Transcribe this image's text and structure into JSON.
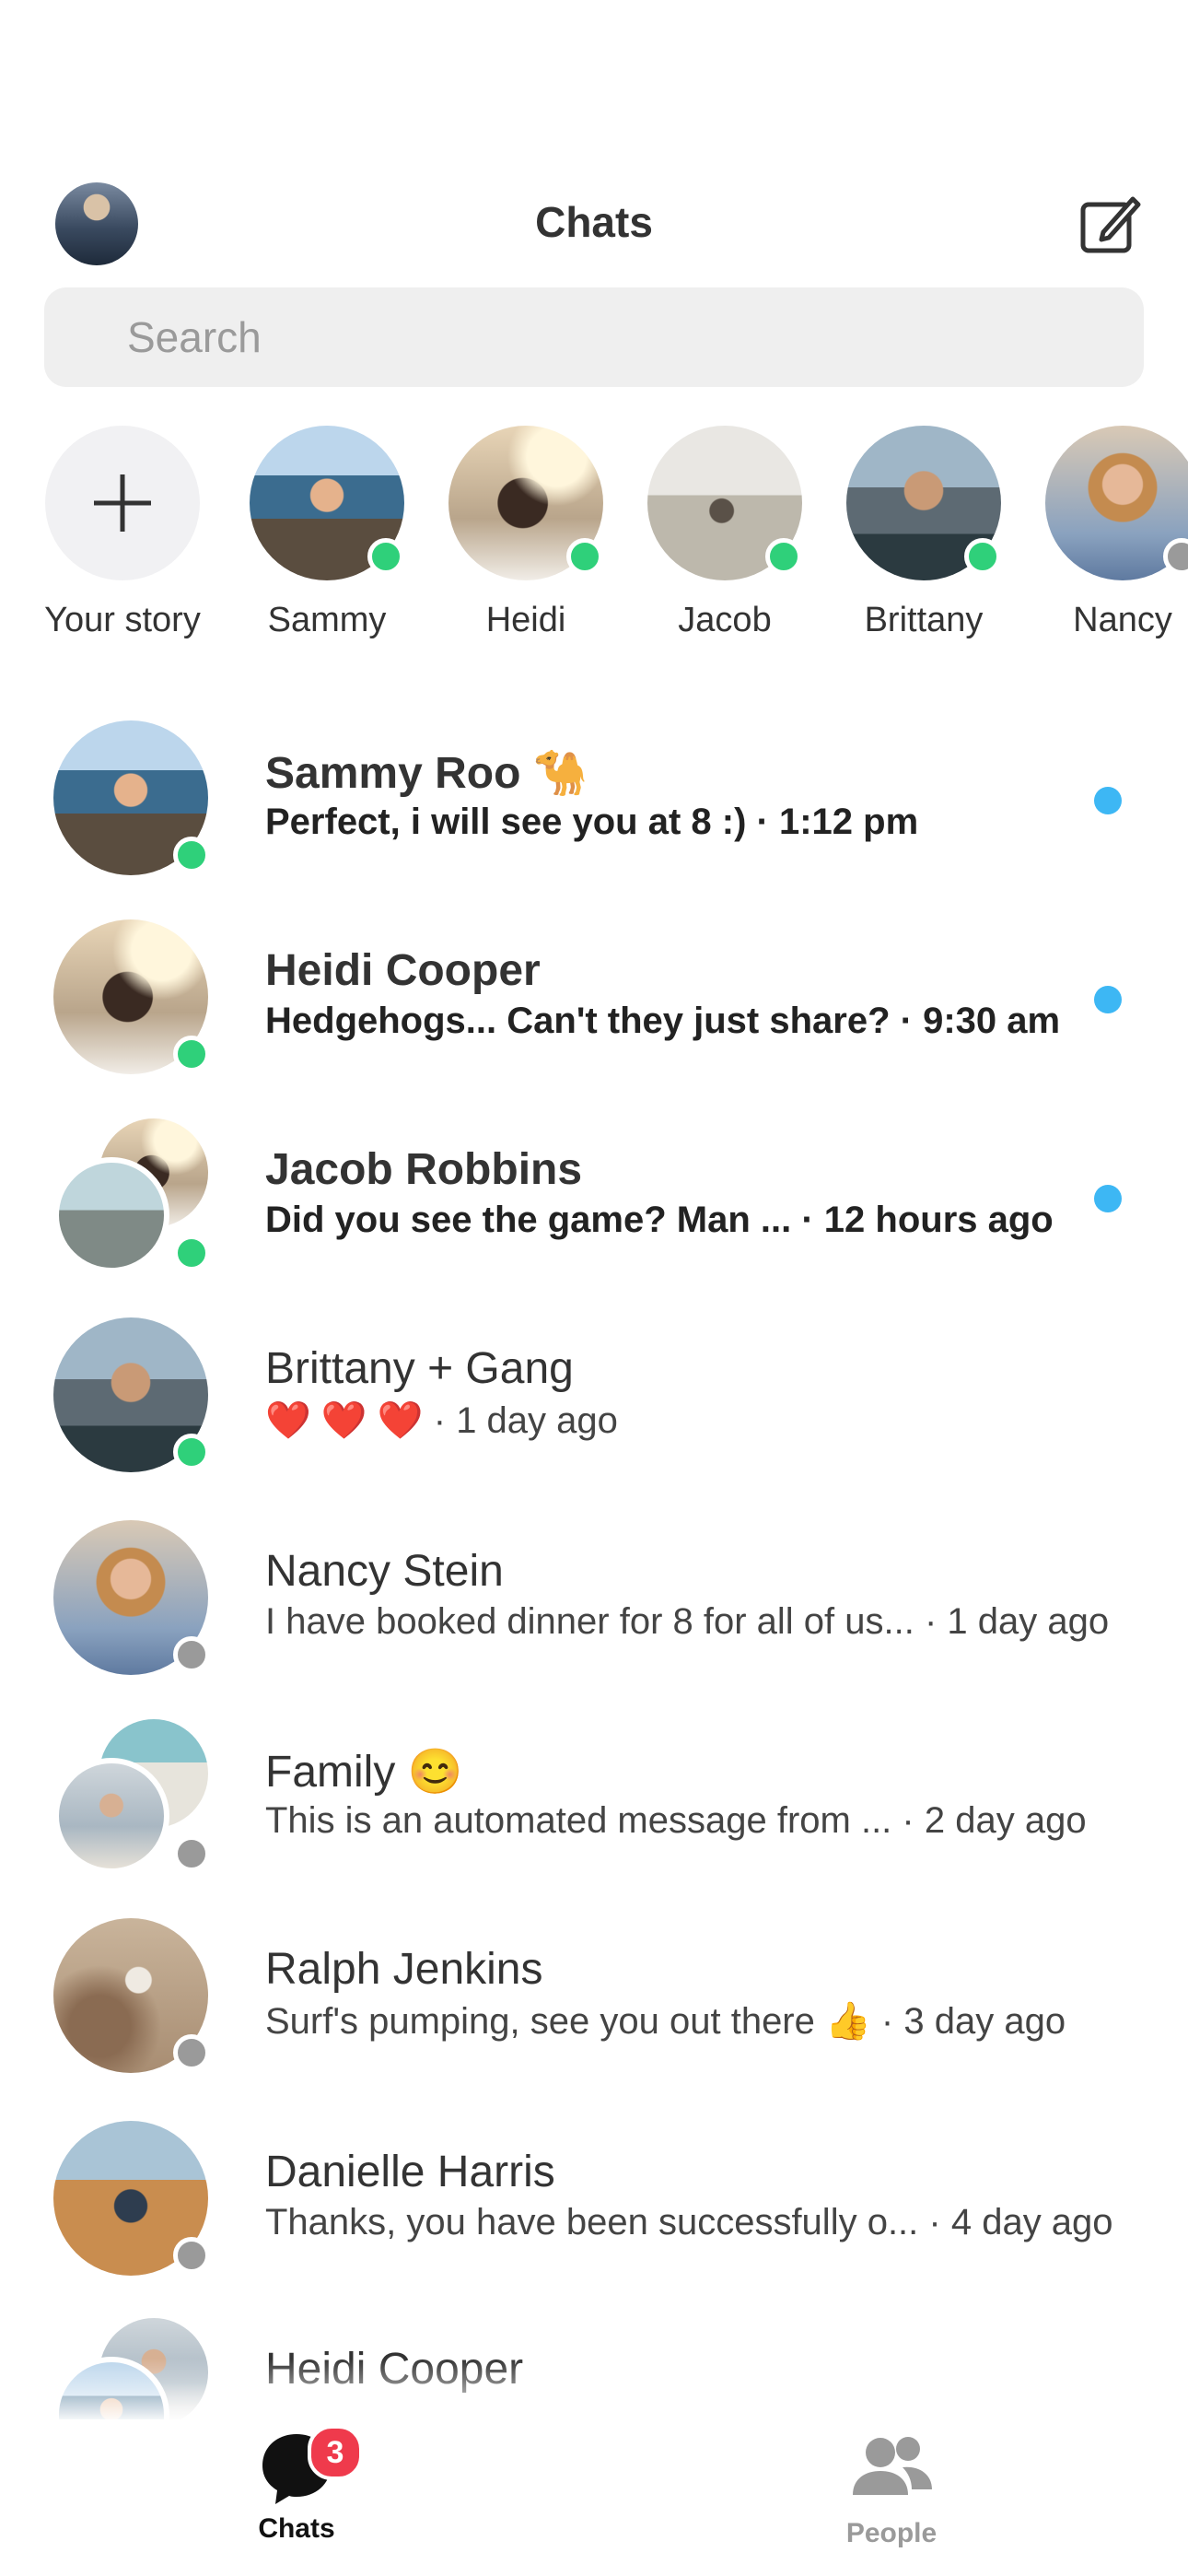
{
  "header": {
    "title": "Chats"
  },
  "search": {
    "placeholder": "Search"
  },
  "stories": [
    {
      "label": "Your story"
    },
    {
      "label": "Sammy",
      "status": "online"
    },
    {
      "label": "Heidi",
      "status": "online"
    },
    {
      "label": "Jacob",
      "status": "online"
    },
    {
      "label": "Brittany",
      "status": "online"
    },
    {
      "label": "Nancy",
      "status": "offline"
    }
  ],
  "chats": [
    {
      "name": "Sammy Roo",
      "emoji": "🐪",
      "preview": "Perfect, i will see you at 8 :)",
      "time": "· 1:12 pm",
      "unread": true,
      "status": "online"
    },
    {
      "name": "Heidi Cooper",
      "preview": "Hedgehogs... Can't they just share?",
      "time": "· 9:30 am",
      "unread": true,
      "status": "online"
    },
    {
      "name": "Jacob Robbins",
      "preview": "Did you see the game? Man ...",
      "time": "· 12 hours ago",
      "unread": true,
      "status": "online"
    },
    {
      "name": "Brittany + Gang",
      "preview": "❤️ ❤️ ❤️",
      "time": "· 1 day ago",
      "unread": false,
      "status": "online"
    },
    {
      "name": "Nancy Stein",
      "preview": "I have booked dinner for 8 for all of us...",
      "time": "· 1 day ago",
      "unread": false,
      "status": "offline"
    },
    {
      "name": "Family",
      "emoji": "😊",
      "preview": "This is an automated message from ...",
      "time": "· 2 day ago",
      "unread": false,
      "status": "offline"
    },
    {
      "name": "Ralph Jenkins",
      "preview": "Surf's pumping, see you out there 👍",
      "time": "· 3 day ago",
      "unread": false,
      "status": "offline"
    },
    {
      "name": "Danielle Harris",
      "preview": "Thanks, you have been successfully o...",
      "time": "· 4 day ago",
      "unread": false,
      "status": "offline"
    },
    {
      "name": "Heidi Cooper",
      "preview": "",
      "time": "",
      "unread": false,
      "status": "offline"
    }
  ],
  "tabs": {
    "chats": {
      "label": "Chats",
      "badge": "3",
      "active": true
    },
    "people": {
      "label": "People",
      "active": false
    }
  },
  "colors": {
    "online": "#2fd07a",
    "unread": "#3db7f4",
    "badge": "#ef3a4c",
    "inactive_tab": "#9a9a9a"
  }
}
